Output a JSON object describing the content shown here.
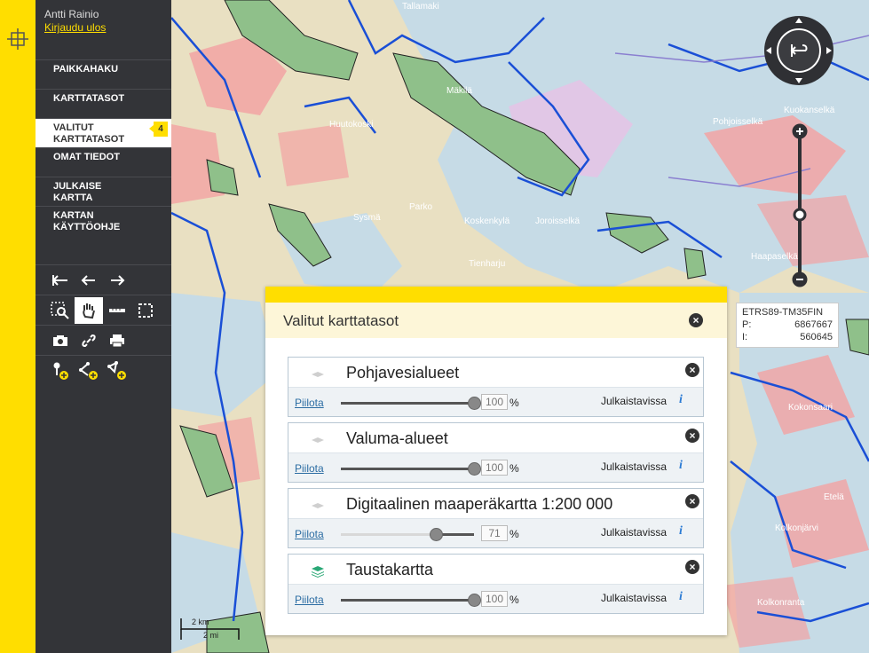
{
  "sidebar": {
    "user_name": "Antti Rainio",
    "logout_label": "Kirjaudu ulos",
    "menu": [
      {
        "label": "PAIKKAHAKU",
        "active": false
      },
      {
        "label": "KARTTATASOT",
        "active": false
      },
      {
        "label": "VALITUT KARTTATASOT",
        "active": true,
        "badge": "4"
      },
      {
        "label": "OMAT TIEDOT",
        "active": false
      },
      {
        "label": "JULKAISE KARTTA",
        "active": false
      },
      {
        "label": "KARTAN KÄYTTÖOHJE",
        "active": false
      }
    ],
    "tools": {
      "row1": [
        "reset-view-icon",
        "undo-icon",
        "redo-icon"
      ],
      "row2": [
        "zoom-box-icon",
        "pan-hand-icon",
        "measure-line-icon",
        "measure-area-icon"
      ],
      "row3": [
        "camera-icon",
        "link-icon",
        "print-icon"
      ],
      "row4": [
        "add-point-icon",
        "add-line-icon",
        "add-area-icon"
      ]
    }
  },
  "map": {
    "place_names": [
      "Huutokoski",
      "Sysmä",
      "Koskenkylä",
      "Haapaselkä",
      "Kuokanselkä",
      "Pohjoisselkä",
      "Joroisselkä",
      "Kolkonjärvi",
      "Kolkonranta",
      "Etelä",
      "Kokonsaari",
      "Parko",
      "Tienharju",
      "Tallamaki",
      "Mäkilä"
    ]
  },
  "coords": {
    "system": "ETRS89-TM35FIN",
    "p_label": "P:",
    "p_value": "6867667",
    "i_label": "I:",
    "i_value": "560645"
  },
  "scale": {
    "km": "2 km",
    "mi": "2 mi"
  },
  "panel": {
    "title": "Valitut karttatasot",
    "hide_label": "Piilota",
    "status_label": "Julkaistavissa",
    "info_label": "i",
    "percent": "%",
    "layers": [
      {
        "name": "Pohjavesialueet",
        "opacity": "100",
        "icon": "layer-hidden-icon"
      },
      {
        "name": "Valuma-alueet",
        "opacity": "100",
        "icon": "layer-hidden-icon"
      },
      {
        "name": "Digitaalinen maaperäkartta 1:200 000",
        "opacity": "71",
        "icon": "layer-hidden-icon"
      },
      {
        "name": "Taustakartta",
        "opacity": "100",
        "icon": "base-map-layers-icon"
      }
    ]
  },
  "colors": {
    "accent": "#ffde00",
    "sidebar": "#333438",
    "water": "#c9dde8",
    "link": "#2c6da3"
  }
}
